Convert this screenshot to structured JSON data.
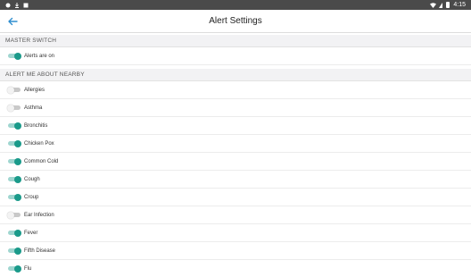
{
  "status_bar": {
    "time": "4:15"
  },
  "app_bar": {
    "title": "Alert Settings"
  },
  "sections": {
    "master": {
      "header": "MASTER SWITCH"
    },
    "nearby": {
      "header": "ALERT ME ABOUT NEARBY"
    }
  },
  "master_switch": {
    "label": "Alerts are on",
    "on": true
  },
  "alerts": [
    {
      "label": "Allergies",
      "on": false
    },
    {
      "label": "Asthma",
      "on": false
    },
    {
      "label": "Bronchitis",
      "on": true
    },
    {
      "label": "Chicken Pox",
      "on": true
    },
    {
      "label": "Common Cold",
      "on": true
    },
    {
      "label": "Cough",
      "on": true
    },
    {
      "label": "Croup",
      "on": true
    },
    {
      "label": "Ear Infection",
      "on": false
    },
    {
      "label": "Fever",
      "on": true
    },
    {
      "label": "Fifth Disease",
      "on": true
    },
    {
      "label": "Flu",
      "on": true
    }
  ],
  "colors": {
    "accent": "#1a9a8a",
    "accent_track": "#9fd6d0",
    "off_track": "#c9c9c9",
    "status_bar": "#4a4a4a",
    "back_arrow": "#2f8ecf"
  }
}
